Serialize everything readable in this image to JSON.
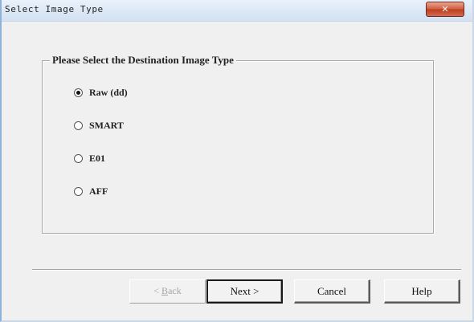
{
  "window": {
    "title": "Select Image Type",
    "close_glyph": "✕"
  },
  "group": {
    "legend": "Please Select the Destination Image Type",
    "options": [
      {
        "label": "Raw (dd)",
        "checked": true
      },
      {
        "label": "SMART",
        "checked": false
      },
      {
        "label": "E01",
        "checked": false
      },
      {
        "label": "AFF",
        "checked": false
      }
    ]
  },
  "buttons": {
    "back_prefix": "< ",
    "back_mnemonic": "B",
    "back_rest": "ack",
    "next": "Next >",
    "cancel": "Cancel",
    "help": "Help"
  }
}
